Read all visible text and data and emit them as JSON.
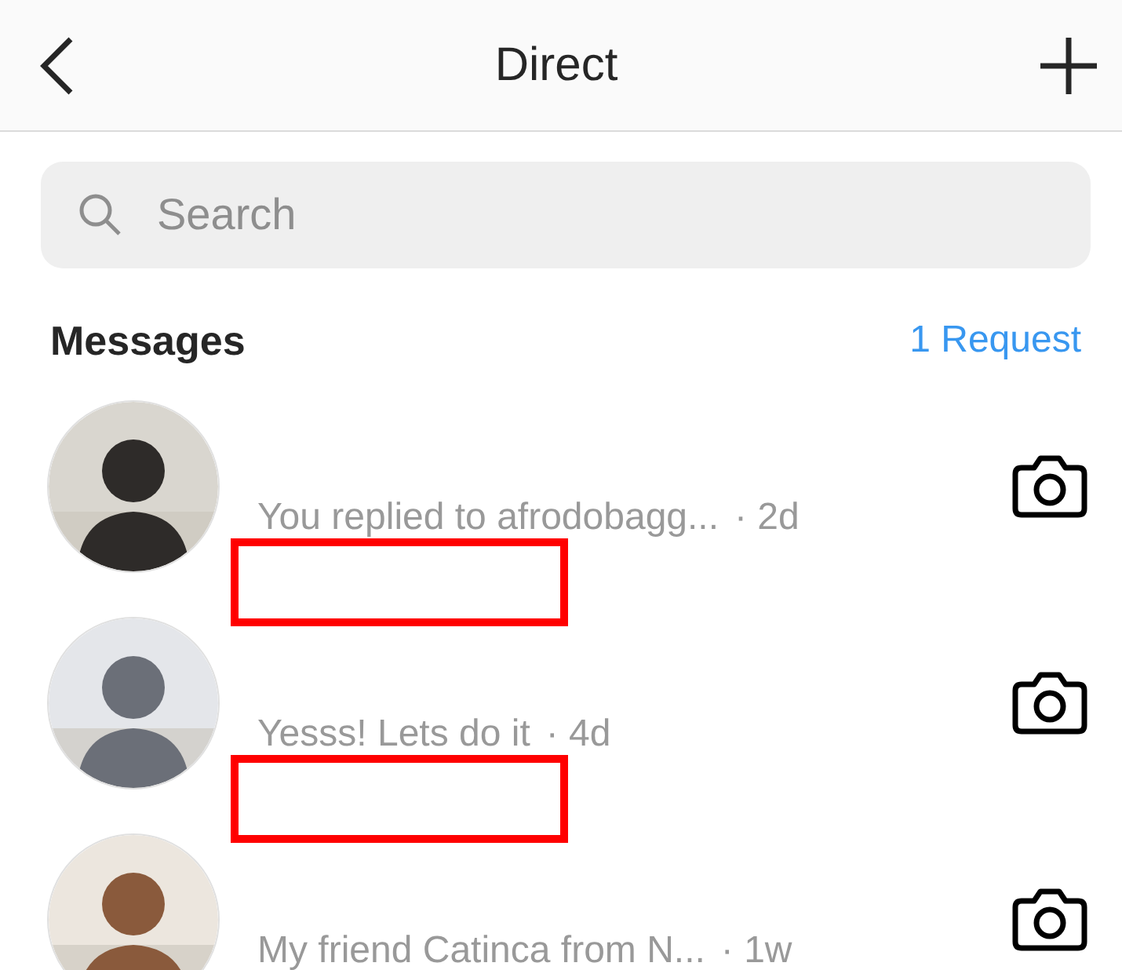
{
  "header": {
    "title": "Direct"
  },
  "search": {
    "placeholder": "Search"
  },
  "section": {
    "title": "Messages",
    "requests_link": "1 Request"
  },
  "conversations": [
    {
      "preview": "You replied to afrodobagg...",
      "time": "· 2d",
      "marked": true
    },
    {
      "preview": "Yesss! Lets do it",
      "time": "· 4d",
      "marked": true
    },
    {
      "preview": "My friend Catinca from N...",
      "time": "· 1w",
      "marked": false
    }
  ]
}
